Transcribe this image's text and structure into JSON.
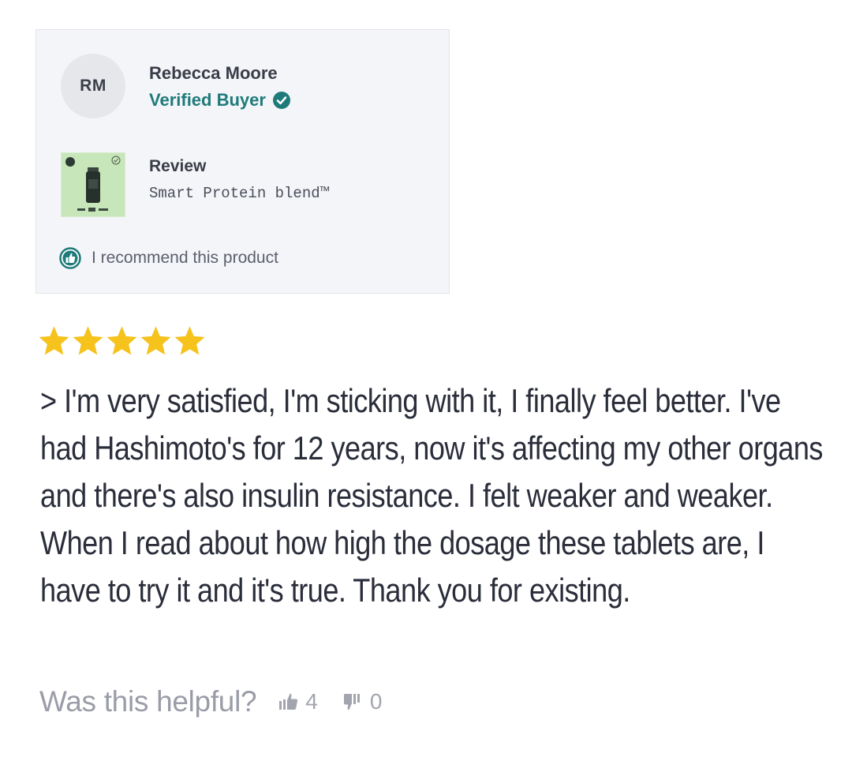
{
  "reviewer": {
    "initials": "RM",
    "name": "Rebecca Moore",
    "badge": "Verified Buyer"
  },
  "product": {
    "section_label": "Review",
    "name": "Smart Protein blend™",
    "thumb_icon": "product-bottle-image"
  },
  "recommendation": {
    "text": "I recommend this product",
    "icon": "thumbs-up-icon"
  },
  "rating": {
    "value": 5,
    "max": 5
  },
  "review": {
    "body": "> I'm very satisfied, I'm sticking with it, I finally feel better. I've had Hashimoto's for 12 years, now it's affecting my other organs and there's also insulin resistance. I felt weaker and weaker. When I read about how high the dosage these tablets are, I have to try it and it's true. Thank you for existing."
  },
  "helpful": {
    "question": "Was this helpful?",
    "up_count": "4",
    "down_count": "0"
  },
  "colors": {
    "accent": "#1f7a7a",
    "star": "#f6c21c",
    "card_bg": "#f4f5f8"
  }
}
